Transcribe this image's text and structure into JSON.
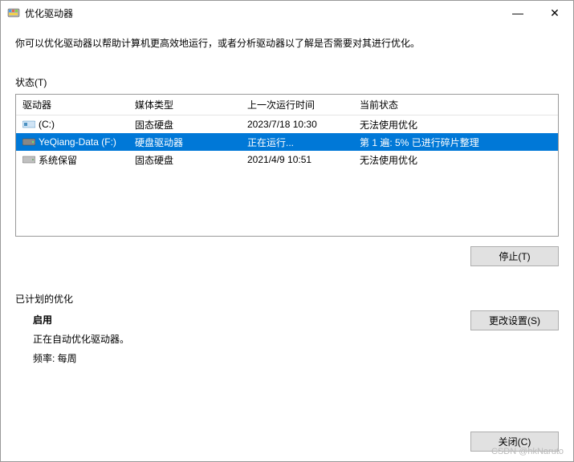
{
  "titlebar": {
    "title": "优化驱动器",
    "minimize": "—",
    "close": "✕"
  },
  "description": "你可以优化驱动器以帮助计算机更高效地运行，或者分析驱动器以了解是否需要对其进行优化。",
  "status_label": "状态(T)",
  "columns": {
    "drive": "驱动器",
    "media": "媒体类型",
    "last_run": "上一次运行时间",
    "current": "当前状态"
  },
  "rows": [
    {
      "icon": "ssd",
      "name": "(C:)",
      "media": "固态硬盘",
      "last_run": "2023/7/18 10:30",
      "status": "无法使用优化",
      "selected": false
    },
    {
      "icon": "hdd",
      "name": "YeQiang-Data (F:)",
      "media": "硬盘驱动器",
      "last_run": "正在运行...",
      "status": "第 1 遍: 5% 已进行碎片整理",
      "selected": true
    },
    {
      "icon": "hdd",
      "name": "系统保留",
      "media": "固态硬盘",
      "last_run": "2021/4/9 10:51",
      "status": "无法使用优化",
      "selected": false
    }
  ],
  "buttons": {
    "stop": "停止(T)",
    "change_settings": "更改设置(S)",
    "close": "关闭(C)"
  },
  "scheduled": {
    "heading": "已计划的优化",
    "enabled": "启用",
    "auto_text": "正在自动优化驱动器。",
    "freq_text": "频率: 每周"
  },
  "watermark": "CSDN @hkNaruto"
}
